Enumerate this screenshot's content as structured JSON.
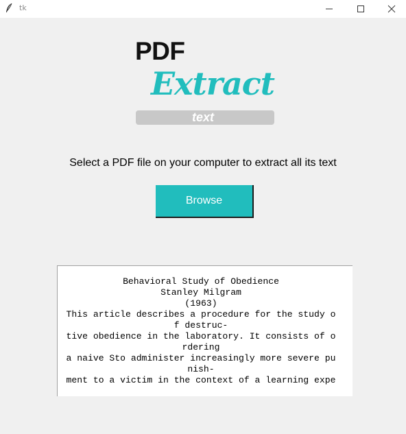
{
  "window": {
    "title": "tk",
    "icons": {
      "app": "feather-icon",
      "minimize": "minimize-icon",
      "maximize": "maximize-icon",
      "close": "close-icon"
    }
  },
  "logo": {
    "line1": "PDF",
    "line2": "Extract",
    "line3": "text",
    "colors": {
      "accent": "#21bdbd",
      "bar": "#c8c8c8"
    }
  },
  "instruction": "Select a PDF file on your computer to extract all its text",
  "browse": {
    "label": "Browse",
    "color": "#21bdbd"
  },
  "output": {
    "lines": [
      "Behavioral Study of Obedience",
      "Stanley Milgram",
      "(1963)",
      "This article describes a procedure for the study o",
      "f destruc-",
      "tive obedience in the laboratory. It consists of o",
      "rdering",
      "a naive Sto administer increasingly more severe pu",
      "nish-",
      "ment to a victim in the context of a learning expe"
    ]
  }
}
